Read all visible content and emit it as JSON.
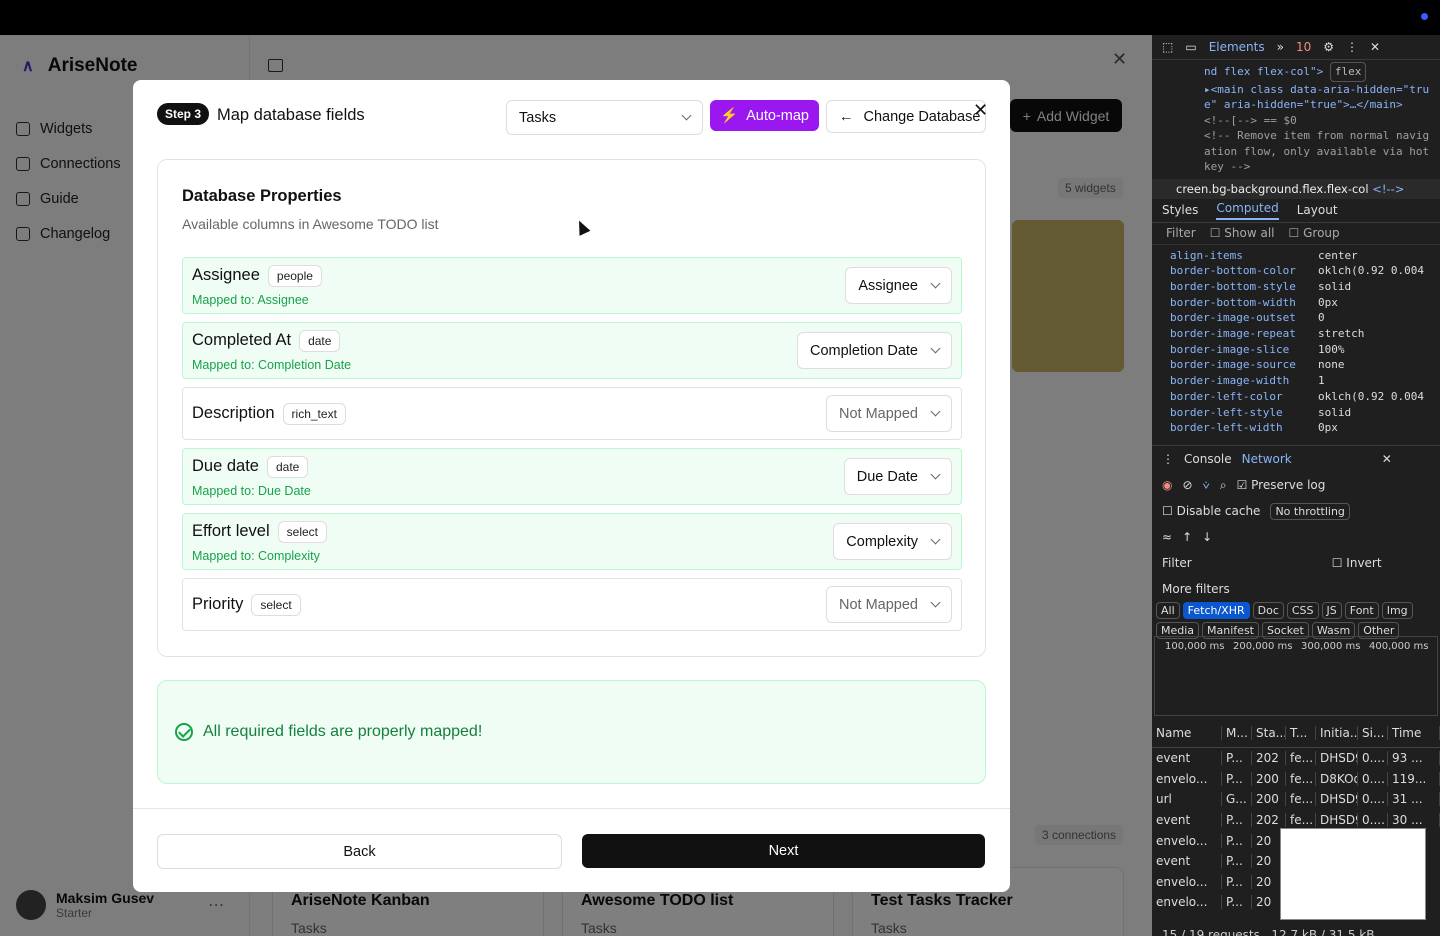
{
  "app": {
    "name": "AriseNote",
    "nav": [
      {
        "label": "Widgets"
      },
      {
        "label": "Connections"
      },
      {
        "label": "Guide"
      },
      {
        "label": "Changelog"
      }
    ],
    "user": {
      "name": "Maksim Gusev",
      "plan": "Starter"
    },
    "add_widget": "Add Widget",
    "widgets_count": "5 widgets",
    "connections_count": "3 connections",
    "connections": [
      {
        "title": "AriseNote Kanban",
        "sub": "Tasks"
      },
      {
        "title": "Awesome TODO list",
        "sub": "Tasks"
      },
      {
        "title": "Test Tasks Tracker",
        "sub": "Tasks"
      }
    ]
  },
  "modal": {
    "step": "Step 3",
    "title": "Map database fields",
    "database_select": "Tasks",
    "automap_label": "Auto-map",
    "change_db_label": "Change Database",
    "props_title": "Database Properties",
    "props_sub": "Available columns in Awesome TODO list",
    "fields": [
      {
        "name": "Assignee",
        "type": "people",
        "mapped": "Mapped to: Assignee",
        "value": "Assignee"
      },
      {
        "name": "Completed At",
        "type": "date",
        "mapped": "Mapped to: Completion Date",
        "value": "Completion Date"
      },
      {
        "name": "Description",
        "type": "rich_text",
        "mapped": "",
        "value": "Not Mapped"
      },
      {
        "name": "Due date",
        "type": "date",
        "mapped": "Mapped to: Due Date",
        "value": "Due Date"
      },
      {
        "name": "Effort level",
        "type": "select",
        "mapped": "Mapped to: Complexity",
        "value": "Complexity"
      },
      {
        "name": "Priority",
        "type": "select",
        "mapped": "",
        "value": "Not Mapped"
      }
    ],
    "success": "All required fields are properly mapped!",
    "back_label": "Back",
    "next_label": "Next"
  },
  "devtools": {
    "tabs": {
      "elements": "Elements",
      "errors": "10"
    },
    "code": [
      "nd flex flex-col\">",
      "▸<main class data-aria-hidden=\"tru",
      "e\" aria-hidden=\"true\">…</main>",
      "<!--[--> == $0",
      "<!-- Remove item from normal navig",
      "ation flow, only available via hot",
      "key -->"
    ],
    "flex_badge": "flex",
    "crumb": "creen.bg-background.flex.flex-col",
    "crumb_comment": "<!-->",
    "subtabs": [
      "Styles",
      "Computed",
      "Layout"
    ],
    "filter_placeholder": "Filter",
    "show_all": "Show all",
    "group": "Group",
    "computed": [
      {
        "k": "align-items",
        "v": "center"
      },
      {
        "k": "border-bottom-color",
        "v": "oklch(0.92 0.004"
      },
      {
        "k": "border-bottom-style",
        "v": "solid"
      },
      {
        "k": "border-bottom-width",
        "v": "0px"
      },
      {
        "k": "border-image-outset",
        "v": "0"
      },
      {
        "k": "border-image-repeat",
        "v": "stretch"
      },
      {
        "k": "border-image-slice",
        "v": "100%"
      },
      {
        "k": "border-image-source",
        "v": "none"
      },
      {
        "k": "border-image-width",
        "v": "1"
      },
      {
        "k": "border-left-color",
        "v": "oklch(0.92 0.004"
      },
      {
        "k": "border-left-style",
        "v": "solid"
      },
      {
        "k": "border-left-width",
        "v": "0px"
      }
    ],
    "drawer_tabs": [
      "Console",
      "Network"
    ],
    "preserve_log": "Preserve log",
    "disable_cache": "Disable cache",
    "throttling": "No throttling",
    "invert": "Invert",
    "more_filters": "More filters",
    "chips": [
      "All",
      "Fetch/XHR",
      "Doc",
      "CSS",
      "JS",
      "Font",
      "Img",
      "Media",
      "Manifest",
      "Socket",
      "Wasm",
      "Other"
    ],
    "timeline": [
      "100,000 ms",
      "200,000 ms",
      "300,000 ms",
      "400,000 ms"
    ],
    "net_head": [
      "Name",
      "M...",
      "Sta...",
      "T...",
      "Initia...",
      "Si...",
      "Time"
    ],
    "net_rows": [
      [
        "event",
        "P...",
        "202",
        "fe...",
        "DHSD9",
        "0....",
        "93 ..."
      ],
      [
        "envelo...",
        "P...",
        "200",
        "fe...",
        "D8KOq",
        "0....",
        "119..."
      ],
      [
        "url",
        "G...",
        "200",
        "fe...",
        "DHSD9",
        "0....",
        "31 ..."
      ],
      [
        "event",
        "P...",
        "202",
        "fe...",
        "DHSD9",
        "0....",
        "30 ..."
      ],
      [
        "envelo...",
        "P...",
        "20",
        "",
        "",
        "",
        ""
      ],
      [
        "event",
        "P...",
        "20",
        "",
        "",
        "",
        ""
      ],
      [
        "envelo...",
        "P...",
        "20",
        "",
        "",
        "",
        ""
      ],
      [
        "envelo...",
        "P...",
        "20",
        "",
        "",
        "",
        ""
      ]
    ],
    "footer": "15 / 19 requests",
    "transfer": "12.7 kB / 31.5 kB transferred"
  }
}
